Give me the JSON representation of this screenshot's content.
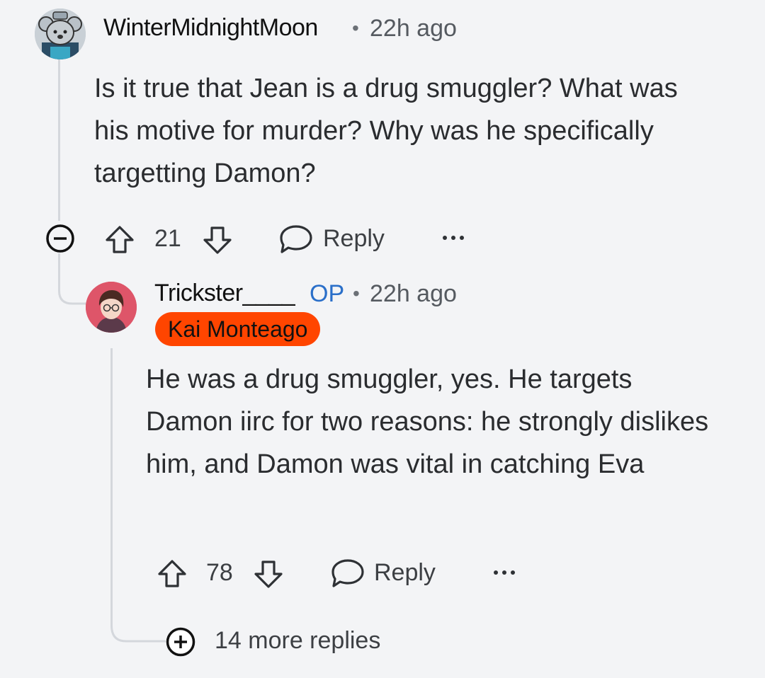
{
  "comments": [
    {
      "username": "WinterMidnightMoon",
      "separator": "•",
      "time": "22h ago",
      "body": "Is it true that Jean is a drug smuggler? What was his motive for murder? Why was he specifically targetting Damon?",
      "votes": "21",
      "reply_label": "Reply",
      "avatar_icon": "koala-avatar-icon"
    },
    {
      "username": "Trickster____",
      "op_badge": "OP",
      "separator": "•",
      "time": "22h ago",
      "flair": "Kai Monteago",
      "body": "He was a drug smuggler, yes. He targets Damon iirc for two reasons: he strongly dislikes him, and Damon was vital in catching Eva",
      "votes": "78",
      "reply_label": "Reply",
      "avatar_icon": "anime-character-avatar-icon"
    }
  ],
  "more_replies": "14 more replies",
  "colors": {
    "flair_bg": "#ff4500",
    "op_blue": "#2a6fc9",
    "thread_line": "#d4d7dc",
    "background": "#f3f4f6"
  }
}
